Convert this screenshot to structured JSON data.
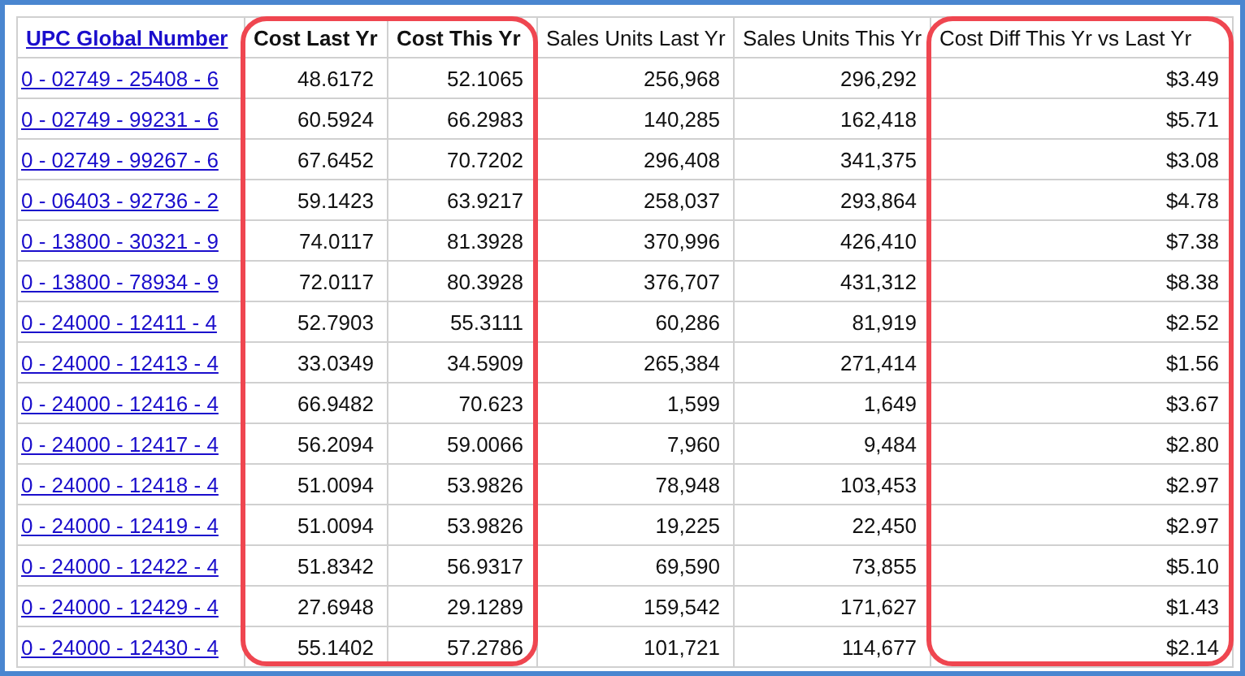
{
  "table": {
    "columns": [
      {
        "label": "UPC Global Number",
        "kind": "link",
        "highlighted": false
      },
      {
        "label": "Cost Last Yr",
        "kind": "bold",
        "highlighted": true
      },
      {
        "label": "Cost This Yr",
        "kind": "bold",
        "highlighted": true
      },
      {
        "label": "Sales Units Last Yr",
        "kind": "plain",
        "highlighted": false
      },
      {
        "label": "Sales Units This Yr",
        "kind": "plain",
        "highlighted": false
      },
      {
        "label": "Cost Diff This Yr vs Last Yr",
        "kind": "plain",
        "highlighted": true
      }
    ],
    "rows": [
      [
        "0 - 02749 - 25408 - 6",
        "48.6172",
        "52.1065",
        "256,968",
        "296,292",
        "$3.49"
      ],
      [
        "0 - 02749 - 99231 - 6",
        "60.5924",
        "66.2983",
        "140,285",
        "162,418",
        "$5.71"
      ],
      [
        "0 - 02749 - 99267 - 6",
        "67.6452",
        "70.7202",
        "296,408",
        "341,375",
        "$3.08"
      ],
      [
        "0 - 06403 - 92736 - 2",
        "59.1423",
        "63.9217",
        "258,037",
        "293,864",
        "$4.78"
      ],
      [
        "0 - 13800 - 30321 - 9",
        "74.0117",
        "81.3928",
        "370,996",
        "426,410",
        "$7.38"
      ],
      [
        "0 - 13800 - 78934 - 9",
        "72.0117",
        "80.3928",
        "376,707",
        "431,312",
        "$8.38"
      ],
      [
        "0 - 24000 - 12411 - 4",
        "52.7903",
        "55.3111",
        "60,286",
        "81,919",
        "$2.52"
      ],
      [
        "0 - 24000 - 12413 - 4",
        "33.0349",
        "34.5909",
        "265,384",
        "271,414",
        "$1.56"
      ],
      [
        "0 - 24000 - 12416 - 4",
        "66.9482",
        "70.623",
        "1,599",
        "1,649",
        "$3.67"
      ],
      [
        "0 - 24000 - 12417 - 4",
        "56.2094",
        "59.0066",
        "7,960",
        "9,484",
        "$2.80"
      ],
      [
        "0 - 24000 - 12418 - 4",
        "51.0094",
        "53.9826",
        "78,948",
        "103,453",
        "$2.97"
      ],
      [
        "0 - 24000 - 12419 - 4",
        "51.0094",
        "53.9826",
        "19,225",
        "22,450",
        "$2.97"
      ],
      [
        "0 - 24000 - 12422 - 4",
        "51.8342",
        "56.9317",
        "69,590",
        "73,855",
        "$5.10"
      ],
      [
        "0 - 24000 - 12429 - 4",
        "27.6948",
        "29.1289",
        "159,542",
        "171,627",
        "$1.43"
      ],
      [
        "0 - 24000 - 12430 - 4",
        "55.1402",
        "57.2786",
        "101,721",
        "114,677",
        "$2.14"
      ]
    ]
  }
}
